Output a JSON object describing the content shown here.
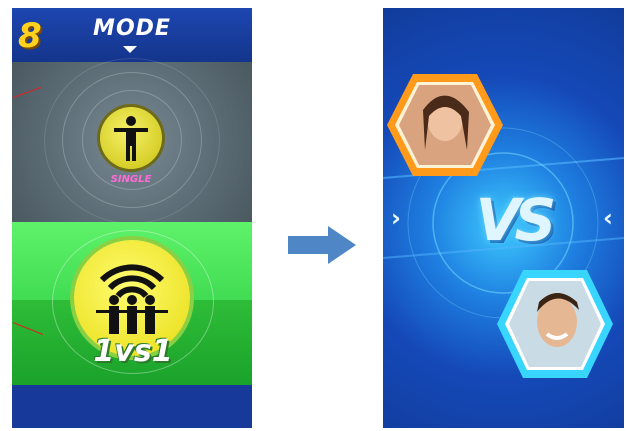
{
  "left_screen": {
    "level": "8",
    "title": "MODE",
    "modes": [
      {
        "label": "SINGLE",
        "selected": false
      },
      {
        "label": "1vs1",
        "selected": true
      }
    ]
  },
  "right_screen": {
    "vs_text": "VS",
    "left_chevron": "›",
    "right_chevron": "‹"
  },
  "colors": {
    "gold": "#ffd21e",
    "single_label": "#ff6ad5",
    "selected_card": "#2fd146",
    "screen_blue": "#1448b8",
    "arrow_blue": "#4f86c6"
  }
}
